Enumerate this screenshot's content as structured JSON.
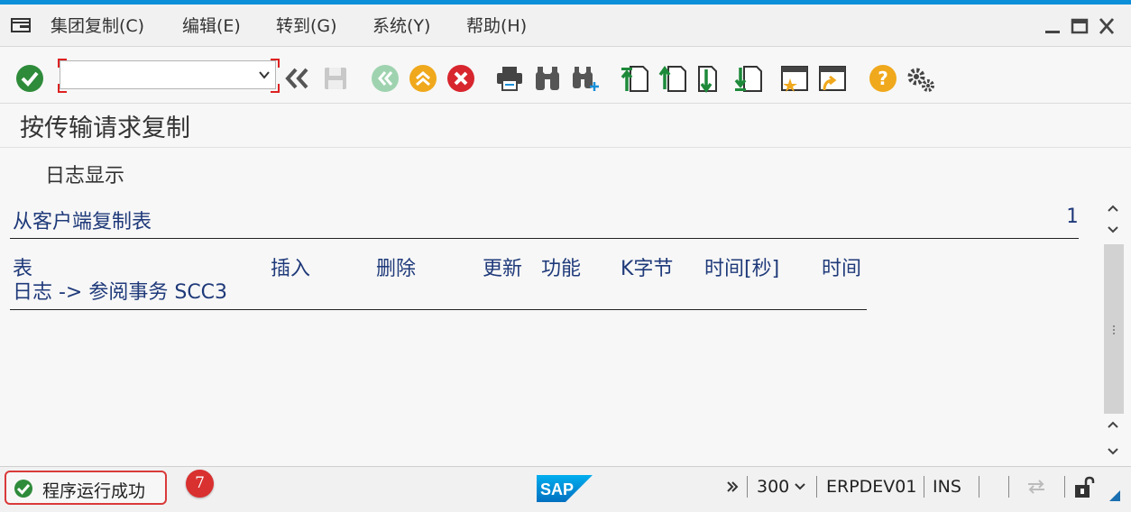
{
  "menubar": {
    "items": [
      {
        "label": "集团复制(C)"
      },
      {
        "label": "编辑(E)"
      },
      {
        "label": "转到(G)"
      },
      {
        "label": "系统(Y)"
      },
      {
        "label": "帮助(H)"
      }
    ]
  },
  "toolbar": {
    "command_field_value": "",
    "icons": [
      "enter-check-icon",
      "back-double-icon",
      "save-icon",
      "back-icon",
      "exit-icon",
      "cancel-icon",
      "print-icon",
      "find-icon",
      "find-next-icon",
      "first-page-icon",
      "previous-page-icon",
      "next-page-icon",
      "last-page-icon",
      "create-session-icon",
      "shortcut-icon",
      "help-icon",
      "settings-icon"
    ]
  },
  "page": {
    "title": "按传输请求复制",
    "subbar_button": "日志显示"
  },
  "report": {
    "title": "从客户端复制表",
    "page_number": "1",
    "columns": [
      "表",
      "插入",
      "删除",
      "更新",
      "功能",
      "K字节",
      "时间[秒]",
      "时间"
    ],
    "log_line": "日志 -> 参阅事务 SCC3"
  },
  "statusbar": {
    "message": "程序运行成功",
    "badge": "7",
    "client": "300",
    "system": "ERPDEV01",
    "mode": "INS",
    "logo_text": "SAP"
  },
  "colors": {
    "accent": "#0a8fd8",
    "report_text": "#1f3a7a",
    "status_highlight": "#d93a3a",
    "success": "#2e8b3a"
  }
}
